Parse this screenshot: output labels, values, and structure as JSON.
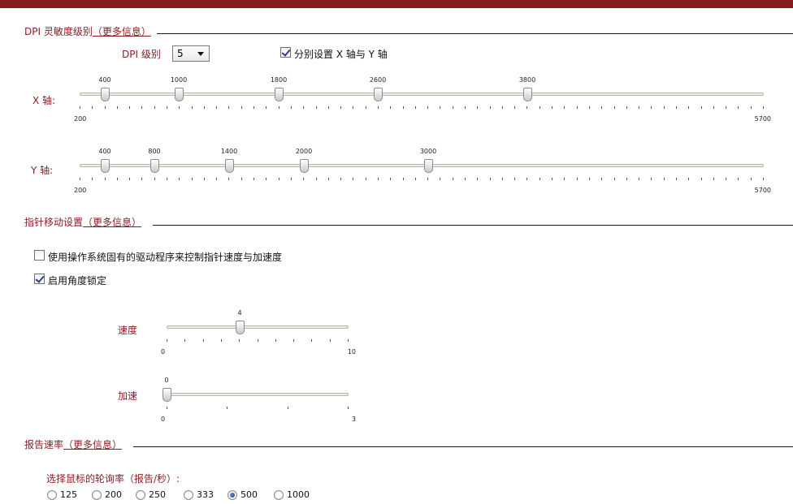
{
  "dpi": {
    "section_title": "DPI 灵敏度级别",
    "more_info": "（更多信息）",
    "level_label": "DPI 级别",
    "level_value": "5",
    "separate_axes_label": "分别设置 X 轴与 Y 轴",
    "separate_axes_checked": true,
    "x_axis": {
      "label": "X 轴:",
      "min": 200,
      "max": 5700,
      "min_label": "200",
      "max_label": "5700",
      "values": [
        400,
        1000,
        1800,
        2600,
        3800
      ],
      "value_labels": [
        "400",
        "1000",
        "1800",
        "2600",
        "3800"
      ]
    },
    "y_axis": {
      "label": "Y 轴:",
      "min": 200,
      "max": 5700,
      "min_label": "200",
      "max_label": "5700",
      "values": [
        400,
        800,
        1400,
        2000,
        3000
      ],
      "value_labels": [
        "400",
        "800",
        "1400",
        "2000",
        "3000"
      ]
    }
  },
  "pointer": {
    "section_title": "指针移动设置",
    "more_info": "（更多信息）",
    "use_os_driver_label": "使用操作系统固有的驱动程序来控制指针速度与加速度",
    "use_os_driver_checked": false,
    "angle_lock_label": "启用角度锁定",
    "angle_lock_checked": true,
    "speed": {
      "label": "速度",
      "min": 0,
      "max": 10,
      "value": 4,
      "min_label": "0",
      "max_label": "10",
      "value_label": "4"
    },
    "accel": {
      "label": "加速",
      "min": 0,
      "max": 3,
      "value": 0,
      "min_label": "0",
      "max_label": "3",
      "value_label": "0"
    }
  },
  "report": {
    "section_title": "报告速率",
    "more_info": "（更多信息）",
    "prompt": "选择鼠标的轮询率（报告/秒）:",
    "options": [
      "125",
      "200",
      "250",
      "333",
      "500",
      "1000"
    ],
    "selected": "500"
  },
  "colors": {
    "accent": "#8b1a1f",
    "top_bar": "#861c22"
  }
}
